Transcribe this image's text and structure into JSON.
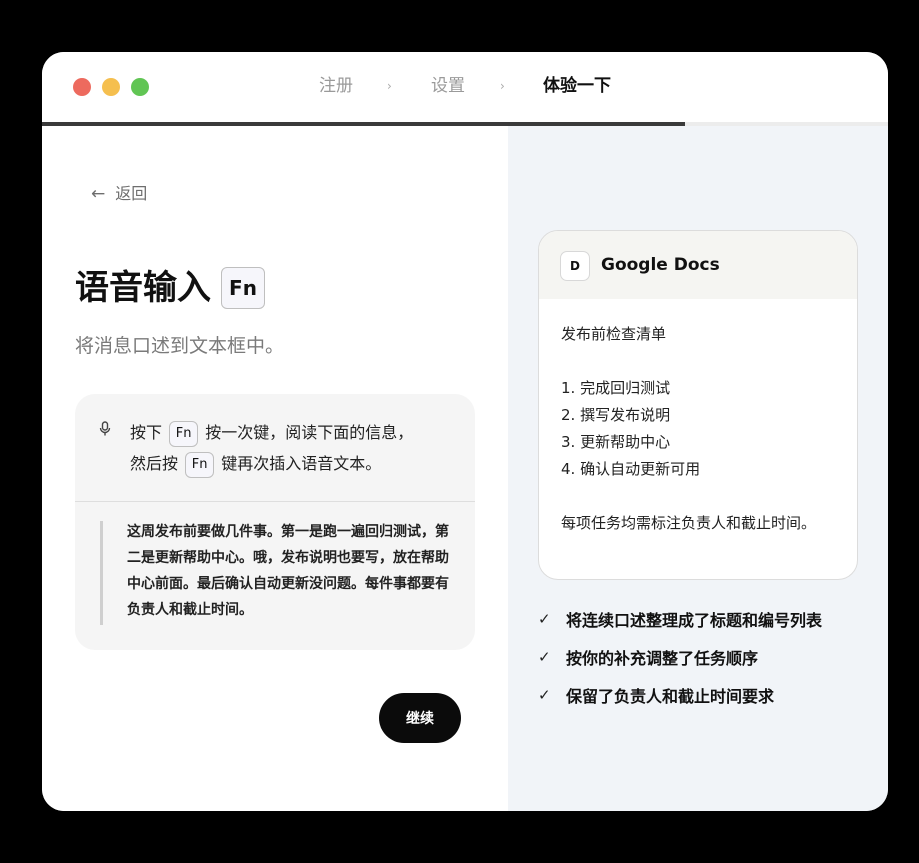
{
  "window": {
    "steps": [
      "注册",
      "设置",
      "体验一下"
    ],
    "active_step": 2,
    "progress": 0.76
  },
  "left": {
    "back_label": "返回",
    "title": "语音输入",
    "title_key": "Fn",
    "subtitle": "将消息口述到文本框中。",
    "instruction": {
      "part1": "按下",
      "key": "Fn",
      "part2": "按一次键，阅读下面的信息，",
      "part3": "然后按",
      "part4": "键再次插入语音文本。"
    },
    "quote": "这周发布前要做几件事。第一是跑一遍回归测试，第二是更新帮助中心。哦，发布说明也要写，放在帮助中心前面。最后确认自动更新没问题。每件事都要有负责人和截止时间。",
    "continue_label": "继续"
  },
  "right": {
    "doc": {
      "app_icon_letter": "D",
      "app_name": "Google Docs",
      "heading": "发布前检查清单",
      "items": [
        "1. 完成回归测试",
        "2. 撰写发布说明",
        "3. 更新帮助中心",
        "4. 确认自动更新可用"
      ],
      "note": "每项任务均需标注负责人和截止时间。"
    },
    "checks": [
      "将连续口述整理成了标题和编号列表",
      "按你的补充调整了任务顺序",
      "保留了负责人和截止时间要求"
    ]
  },
  "icons": {
    "back": "arrow-left-icon",
    "mic": "microphone-icon",
    "check": "checkmark-icon"
  },
  "colors": {
    "traffic_red": "#ed6a5e",
    "traffic_yellow": "#f5bf4f",
    "traffic_green": "#61c554",
    "button": "#0b0b0b",
    "right_panel": "#f1f4f8"
  }
}
